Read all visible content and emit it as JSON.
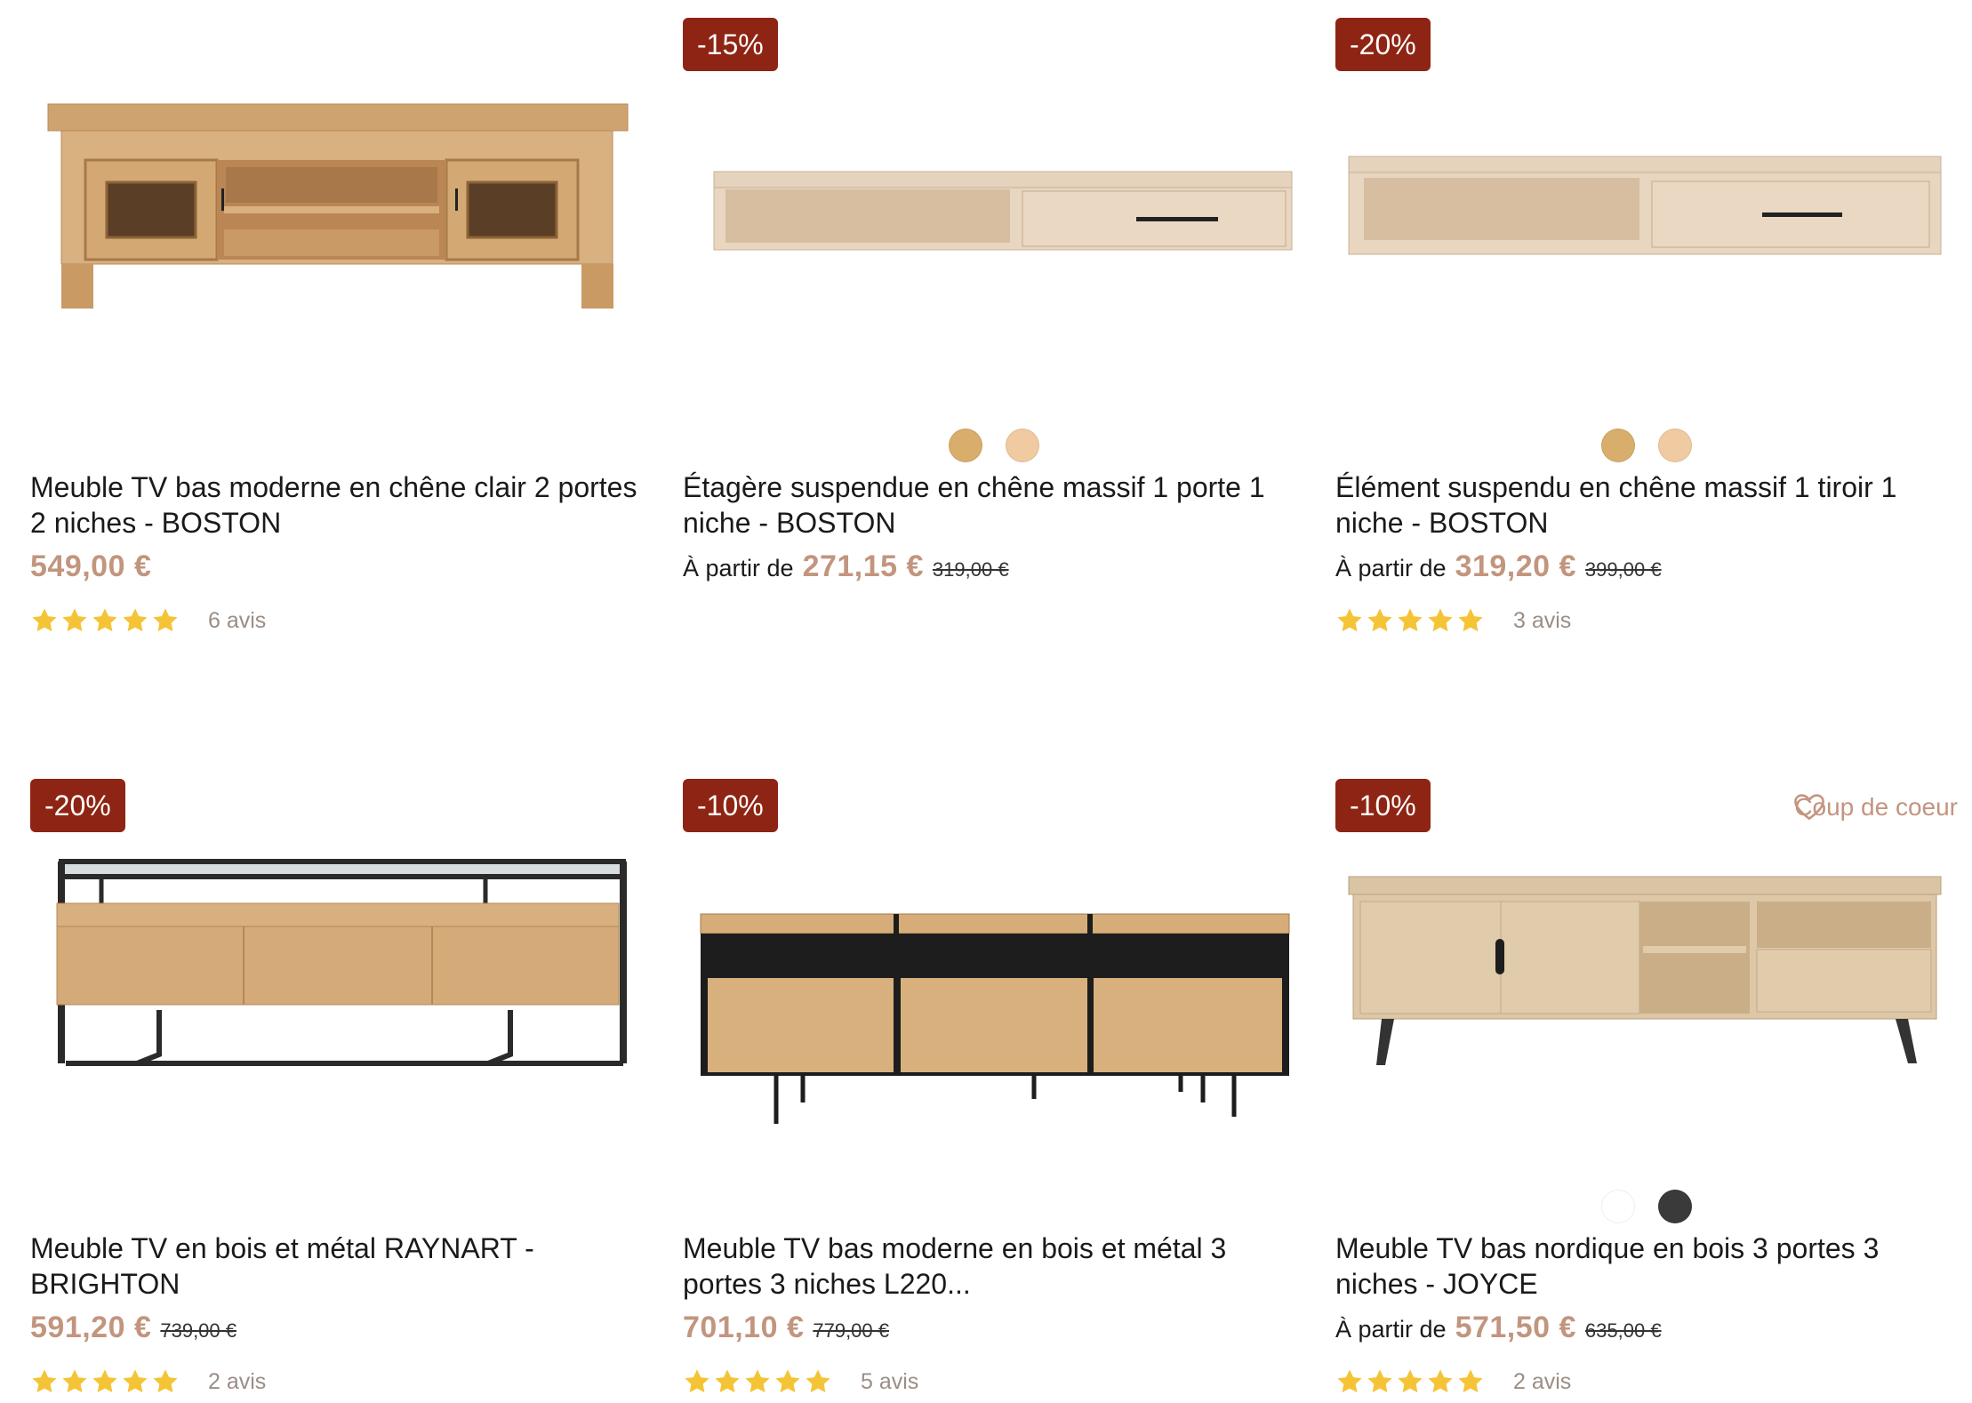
{
  "colors": {
    "badge": "#8e2413",
    "price": "#c2957e",
    "star": "#f4c436",
    "favorite": "#c2957e"
  },
  "products": [
    {
      "badge": "",
      "favorite_label": "",
      "swatches": [],
      "title": "Meuble TV bas moderne en chêne clair 2 portes 2 niches - BOSTON",
      "from_label": "",
      "price": "549,00 €",
      "old_price": "",
      "rating": 5,
      "reviews": "6 avis",
      "icon": "oak-tv-cabinet-image"
    },
    {
      "badge": "-15%",
      "favorite_label": "",
      "swatches": [
        "#d9ad6c",
        "#f0caa0"
      ],
      "title": "Étagère suspendue en chêne massif 1 porte 1 niche - BOSTON",
      "from_label": "À partir de",
      "price": "271,15 €",
      "old_price": "319,00 €",
      "rating": null,
      "reviews": "",
      "icon": "floating-shelf-image"
    },
    {
      "badge": "-20%",
      "favorite_label": "",
      "swatches": [
        "#d9ad6c",
        "#f0caa0"
      ],
      "title": "Élément suspendu en chêne massif 1 tiroir 1 niche - BOSTON",
      "from_label": "À partir de",
      "price": "319,20 €",
      "old_price": "399,00 €",
      "rating": 5,
      "reviews": "3 avis",
      "icon": "floating-drawer-unit-image"
    },
    {
      "badge": "-20%",
      "favorite_label": "",
      "swatches": [],
      "title": "Meuble TV en bois et métal RAYNART - BRIGHTON",
      "from_label": "",
      "price": "591,20 €",
      "old_price": "739,00 €",
      "rating": 5,
      "reviews": "2 avis",
      "icon": "glass-metal-tv-stand-image"
    },
    {
      "badge": "-10%",
      "favorite_label": "",
      "swatches": [],
      "title": "Meuble TV bas moderne en bois et métal 3 portes 3 niches L220...",
      "from_label": "",
      "price": "701,10 €",
      "old_price": "779,00 €",
      "rating": 5,
      "reviews": "5 avis",
      "icon": "wood-metal-sideboard-image"
    },
    {
      "badge": "-10%",
      "favorite_label": "Coup de coeur",
      "swatches": [
        "#ffffff",
        "#3a3a3a"
      ],
      "title": "Meuble TV bas nordique en bois 3 portes 3 niches - JOYCE",
      "from_label": "À partir de",
      "price": "571,50 €",
      "old_price": "635,00 €",
      "rating": 5,
      "reviews": "2 avis",
      "icon": "nordic-tv-cabinet-image"
    }
  ]
}
